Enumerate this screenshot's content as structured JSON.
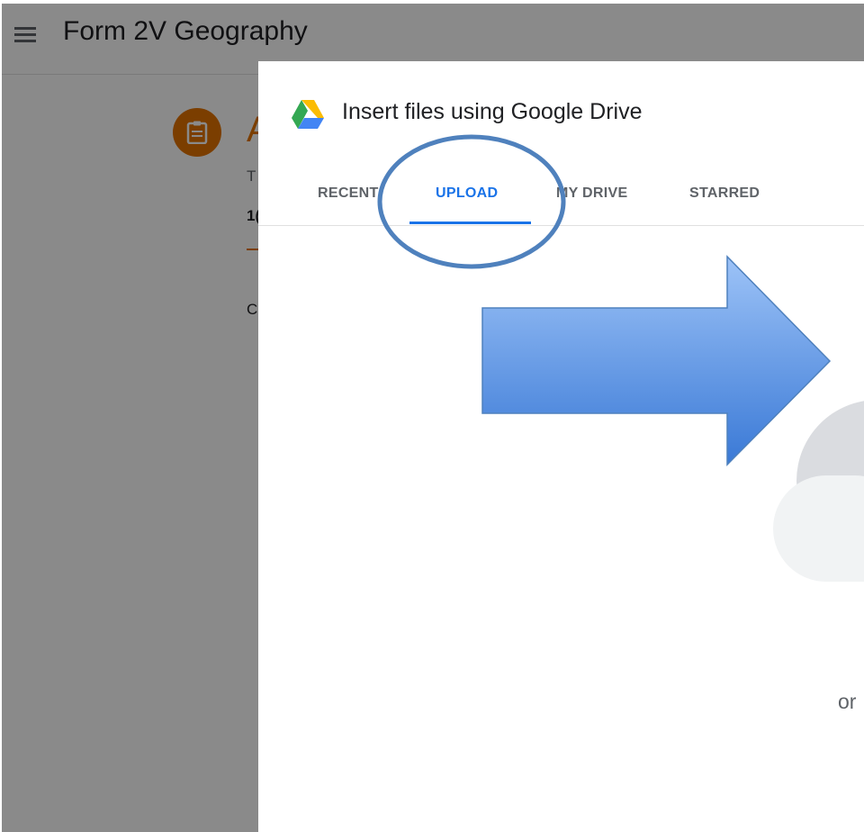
{
  "classroom": {
    "title": "Form 2V Geography",
    "assignment_title_initial": "A",
    "assignment_sub_initial": "T",
    "assignment_points_initial": "1(",
    "assignment_body_initial": "C",
    "accent_color": "#e37400"
  },
  "dialog": {
    "title": "Insert files using Google Drive",
    "tabs": [
      {
        "label": "RECENT",
        "active": false
      },
      {
        "label": "UPLOAD",
        "active": true
      },
      {
        "label": "MY DRIVE",
        "active": false
      },
      {
        "label": "STARRED",
        "active": false
      }
    ],
    "body_text": "or",
    "accent_color": "#1a73e8"
  },
  "icons": {
    "menu": "hamburger-menu-icon",
    "assignment": "assignment-icon",
    "drive": "google-drive-icon",
    "illustration": "cloud-upload-illustration"
  },
  "annotations": {
    "highlight": "circle-around-upload-tab",
    "arrow": "blue-arrow-pointing-right",
    "color": "#4f81bd"
  }
}
